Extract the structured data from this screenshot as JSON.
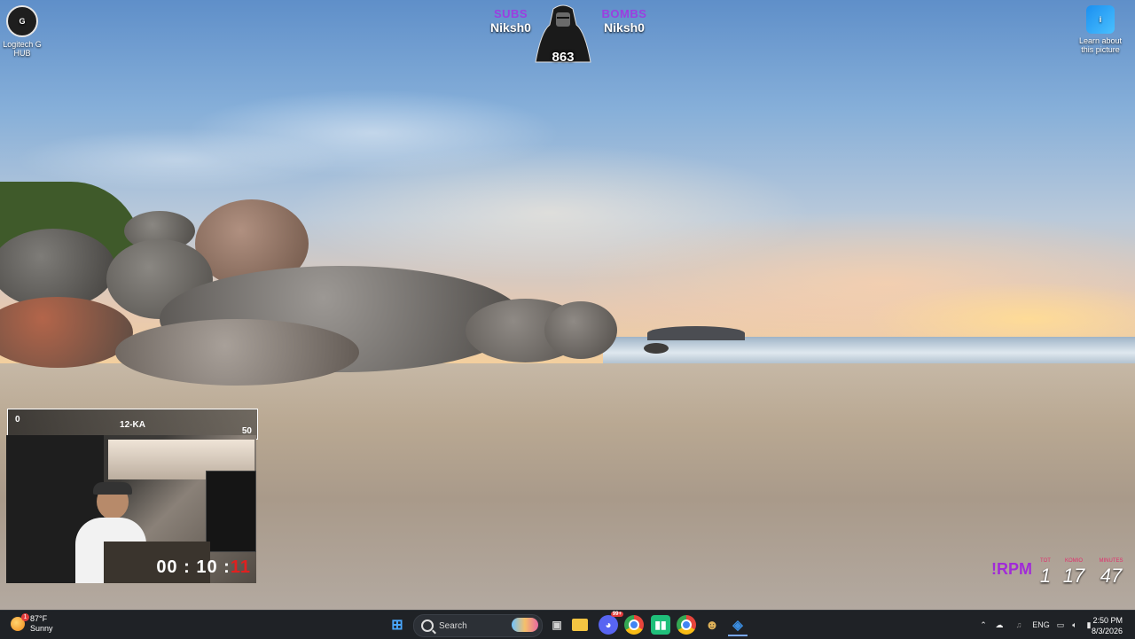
{
  "desktop": {
    "icons": [
      {
        "label": "Logitech G HUB",
        "glyph": "G"
      },
      {
        "label": "Learn about this picture",
        "glyph": "i"
      }
    ]
  },
  "overlay": {
    "subs": {
      "label": "SUBS",
      "name": "Niksh0"
    },
    "bombs": {
      "label": "BOMBS",
      "name": "Niksh0"
    },
    "mascot_count": "863"
  },
  "goal_bar": {
    "min": "0",
    "name": "12-KA",
    "max": "50"
  },
  "webcam": {
    "timer_hours": "00",
    "timer_sep": ":",
    "timer_minutes": "10",
    "timer_sep2": ":",
    "timer_seconds": "11"
  },
  "rpm_widget": {
    "tag": "!RPM",
    "cells": [
      {
        "header": "TOT",
        "value": "1"
      },
      {
        "header": "KOMIO",
        "value": "17"
      },
      {
        "header": "MINUTES",
        "value": "47"
      }
    ]
  },
  "taskbar": {
    "weather": {
      "temp": "87°F",
      "condition": "Sunny",
      "badge": "1"
    },
    "search_placeholder": "Search",
    "apps": [
      {
        "name": "start",
        "glyph": "⊞",
        "color": "#4aa8ff"
      },
      {
        "name": "task-view",
        "glyph": "▣",
        "color": "#d0d0d0"
      },
      {
        "name": "file-explorer",
        "glyph": "▬",
        "color": "#f4c542"
      },
      {
        "name": "discord",
        "glyph": "◕",
        "color": "#7289da",
        "badge": "99+"
      },
      {
        "name": "chrome",
        "glyph": "◉",
        "color": "#e8453c"
      },
      {
        "name": "audio-app",
        "glyph": "▮",
        "color": "#2fd38a"
      },
      {
        "name": "chrome-alt",
        "glyph": "◉",
        "color": "#e8453c"
      },
      {
        "name": "game-app",
        "glyph": "☻",
        "color": "#e0b35a"
      },
      {
        "name": "vscode-like",
        "glyph": "◈",
        "color": "#3b8de0"
      }
    ],
    "tray": {
      "language": "ENG"
    },
    "clock": {
      "time": "2:50 PM",
      "date": "8/3/2026"
    }
  }
}
